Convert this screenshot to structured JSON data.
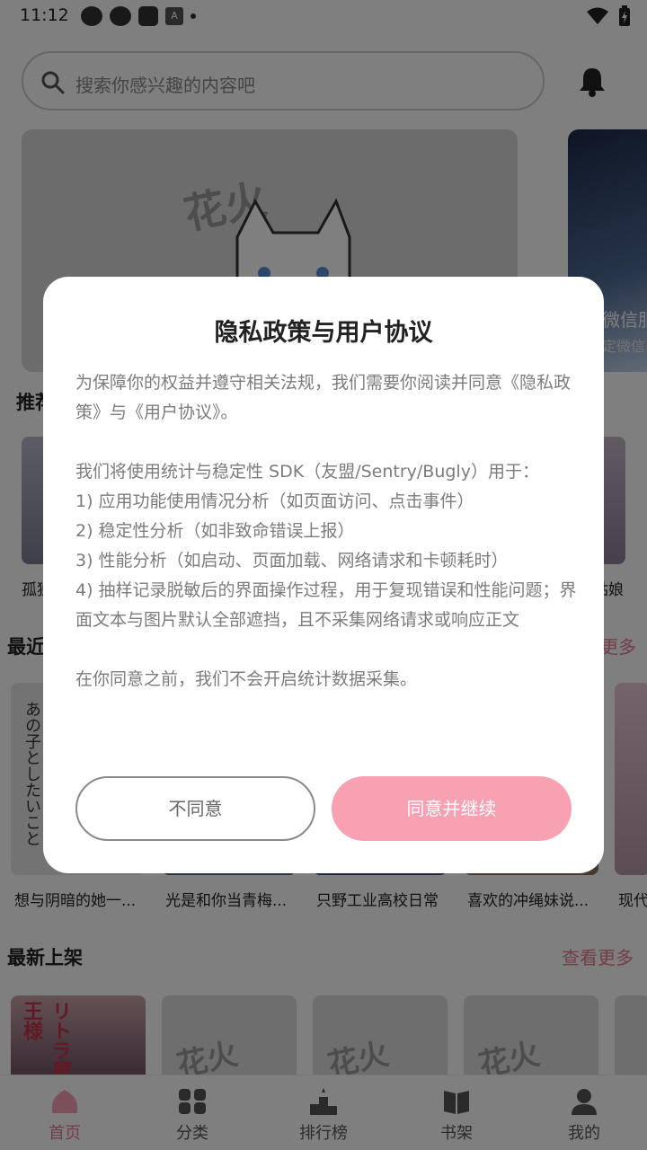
{
  "status_bar": {
    "time": "11:12",
    "notif_icon_letter": "A"
  },
  "search": {
    "placeholder": "搜索你感兴趣的内容吧"
  },
  "banner": {
    "placeholder_text": "花火",
    "side_title": "微信服",
    "side_subtitle": "定微信"
  },
  "sections": {
    "recommend": {
      "title": "推荐"
    },
    "recent": {
      "title": "最近",
      "see_more": "更多"
    },
    "new_arrivals": {
      "title": "最新上架",
      "see_more": "查看更多"
    }
  },
  "recommend_items": [
    {
      "title": "孤独"
    },
    {
      "title": "姑娘"
    }
  ],
  "recent_items": [
    {
      "title": "想与阴暗的她一..."
    },
    {
      "title": "光是和你当青梅..."
    },
    {
      "title": "只野工业高校日常"
    },
    {
      "title": "喜欢的冲绳妹说..."
    },
    {
      "title": "现代"
    }
  ],
  "recent_first_cover": {
    "text": "あの子としたいこと"
  },
  "new_arrivals_covers": [
    {
      "text": "リトラ魔王様"
    },
    {
      "text": "花火"
    },
    {
      "text": "花火"
    },
    {
      "text": "花火"
    }
  ],
  "bottom_nav": [
    {
      "label": "首页",
      "icon": "home-icon",
      "active": true
    },
    {
      "label": "分类",
      "icon": "category-icon",
      "active": false
    },
    {
      "label": "排行榜",
      "icon": "ranking-icon",
      "active": false
    },
    {
      "label": "书架",
      "icon": "bookshelf-icon",
      "active": false
    },
    {
      "label": "我的",
      "icon": "profile-icon",
      "active": false
    }
  ],
  "dialog": {
    "title": "隐私政策与用户协议",
    "paragraph1": "为保障你的权益并遵守相关法规，我们需要你阅读并同意《隐私政策》与《用户协议》。",
    "paragraph2": "我们将使用统计与稳定性 SDK（友盟/Sentry/Bugly）用于：\n1) 应用功能使用情况分析（如页面访问、点击事件）\n2) 稳定性分析（如非致命错误上报）\n3) 性能分析（如启动、页面加载、网络请求和卡顿耗时）\n4) 抽样记录脱敏后的界面操作过程，用于复现错误和性能问题；界面文本与图片默认全部遮挡，且不采集网络请求或响应正文",
    "paragraph3": "在你同意之前，我们不会开启统计数据采集。",
    "decline_label": "不同意",
    "accept_label": "同意并继续"
  },
  "colors": {
    "accent": "#e87a8e",
    "accept_button": "#f7a1b2",
    "overlay": "rgba(0,0,0,0.5)"
  }
}
